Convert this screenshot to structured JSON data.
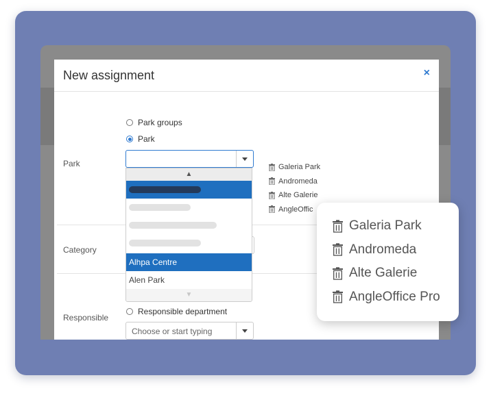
{
  "modal": {
    "title": "New assignment",
    "close_label": "×"
  },
  "park_field": {
    "label": "Park",
    "radio_options": [
      {
        "label": "Park groups",
        "checked": false
      },
      {
        "label": "Park",
        "checked": true
      }
    ],
    "input_value": "",
    "dropdown": {
      "scroll_up": "▲",
      "scroll_down": "▼",
      "options": [
        {
          "label": "",
          "redacted": true,
          "selected": true
        },
        {
          "label": "",
          "redacted": true,
          "selected": false
        },
        {
          "label": "",
          "redacted": true,
          "selected": false
        },
        {
          "label": "",
          "redacted": true,
          "selected": false
        },
        {
          "label": "Alhpa Centre",
          "redacted": false,
          "selected": true
        },
        {
          "label": "Alen Park",
          "redacted": false,
          "selected": false
        }
      ]
    },
    "selected_parks": [
      "Galeria Park",
      "Andromeda",
      "Alte Galerie",
      "AngleOffice Pro"
    ],
    "selected_parks_truncated_last": "AngleOffic"
  },
  "category_field": {
    "label": "Category"
  },
  "responsible_field": {
    "label": "Responsible",
    "radio_label": "Responsible department",
    "select_placeholder": "Choose or start typing"
  },
  "callout": {
    "items": [
      "Galeria Park",
      "Andromeda",
      "Alte Galerie",
      "AngleOffice Pro"
    ],
    "icon": "trash-icon"
  },
  "colors": {
    "frame": "#6f7fb3",
    "accent": "#2f7ad0",
    "selection": "#1f6fbf"
  }
}
